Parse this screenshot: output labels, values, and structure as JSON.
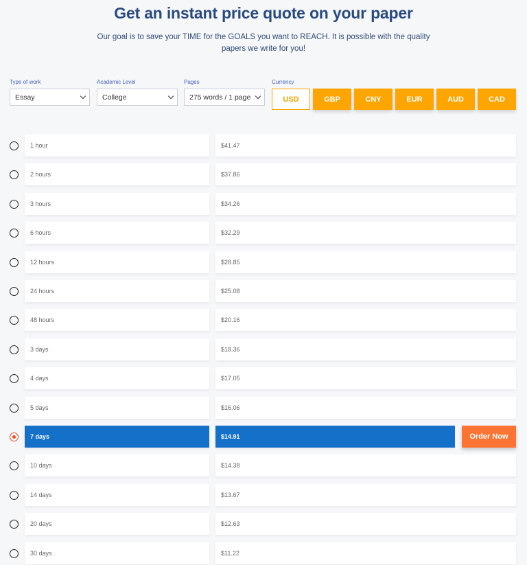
{
  "header": {
    "title": "Get an instant price quote on your paper",
    "subtitle": "Our goal is to save your TIME for the GOALS you want to REACH. It is possible with the quality papers we write for you!"
  },
  "form": {
    "type_of_work": {
      "label": "Type of work",
      "value": "Essay"
    },
    "academic_level": {
      "label": "Academic Level",
      "value": "College"
    },
    "pages": {
      "label": "Pages",
      "value": "275 words / 1 page"
    },
    "currency": {
      "label": "Currency",
      "options": [
        "USD",
        "GBP",
        "CNY",
        "EUR",
        "AUD",
        "CAD"
      ],
      "selected": "USD"
    }
  },
  "deadlines": [
    {
      "time": "1 hour",
      "price": "$41.47"
    },
    {
      "time": "2 hours",
      "price": "$37.86"
    },
    {
      "time": "3 hours",
      "price": "$34.26"
    },
    {
      "time": "6 hours",
      "price": "$32.29"
    },
    {
      "time": "12 hours",
      "price": "$28.85"
    },
    {
      "time": "24 hours",
      "price": "$25.08"
    },
    {
      "time": "48 hours",
      "price": "$20.16"
    },
    {
      "time": "3 days",
      "price": "$18.36"
    },
    {
      "time": "4 days",
      "price": "$17.05"
    },
    {
      "time": "5 days",
      "price": "$16.06"
    },
    {
      "time": "7 days",
      "price": "$14.91",
      "selected": true
    },
    {
      "time": "10 days",
      "price": "$14.38"
    },
    {
      "time": "14 days",
      "price": "$13.67"
    },
    {
      "time": "20 days",
      "price": "$12.63"
    },
    {
      "time": "30 days",
      "price": "$11.22"
    }
  ],
  "order_button": "Order Now",
  "colors": {
    "accent_orange": "#ffa500",
    "selected_blue": "#1570c9",
    "order_orange": "#ff7433",
    "title_navy": "#2a4a7f"
  }
}
